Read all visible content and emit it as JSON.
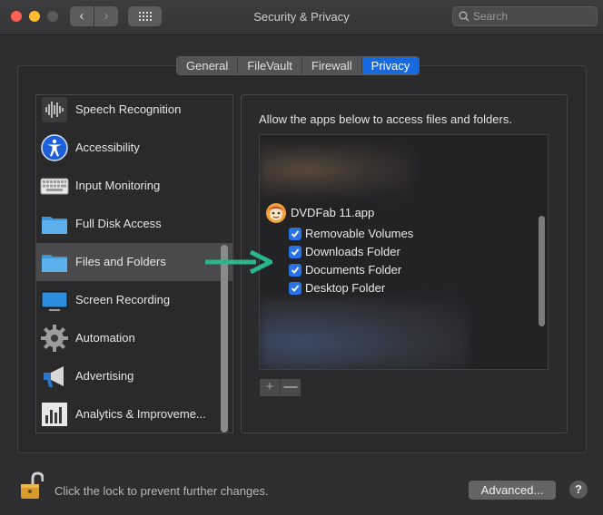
{
  "window": {
    "title": "Security & Privacy"
  },
  "search": {
    "placeholder": "Search"
  },
  "tabs": [
    {
      "label": "General"
    },
    {
      "label": "FileVault"
    },
    {
      "label": "Firewall"
    },
    {
      "label": "Privacy",
      "active": true
    }
  ],
  "sidebar": {
    "items": [
      {
        "label": "Speech Recognition",
        "icon": "waveform-icon"
      },
      {
        "label": "Accessibility",
        "icon": "accessibility-icon"
      },
      {
        "label": "Input Monitoring",
        "icon": "keyboard-icon"
      },
      {
        "label": "Full Disk Access",
        "icon": "folder-icon"
      },
      {
        "label": "Files and Folders",
        "icon": "folder-icon",
        "selected": true
      },
      {
        "label": "Screen Recording",
        "icon": "display-icon"
      },
      {
        "label": "Automation",
        "icon": "gear-icon"
      },
      {
        "label": "Advertising",
        "icon": "megaphone-icon"
      },
      {
        "label": "Analytics & Improveme...",
        "icon": "bar-chart-icon"
      }
    ]
  },
  "detail": {
    "instruction": "Allow the apps below to access files and folders.",
    "app": {
      "name": "DVDFab 11.app",
      "permissions": [
        {
          "label": "Removable Volumes",
          "checked": true
        },
        {
          "label": "Downloads Folder",
          "checked": true
        },
        {
          "label": "Documents Folder",
          "checked": true
        },
        {
          "label": "Desktop Folder",
          "checked": true
        }
      ]
    },
    "add_label": "+",
    "remove_label": "—"
  },
  "footer": {
    "lock_text": "Click the lock to prevent further changes.",
    "advanced_label": "Advanced...",
    "help_label": "?"
  },
  "colors": {
    "accent": "#1769e0",
    "annotation_arrow": "#2bb58a"
  }
}
